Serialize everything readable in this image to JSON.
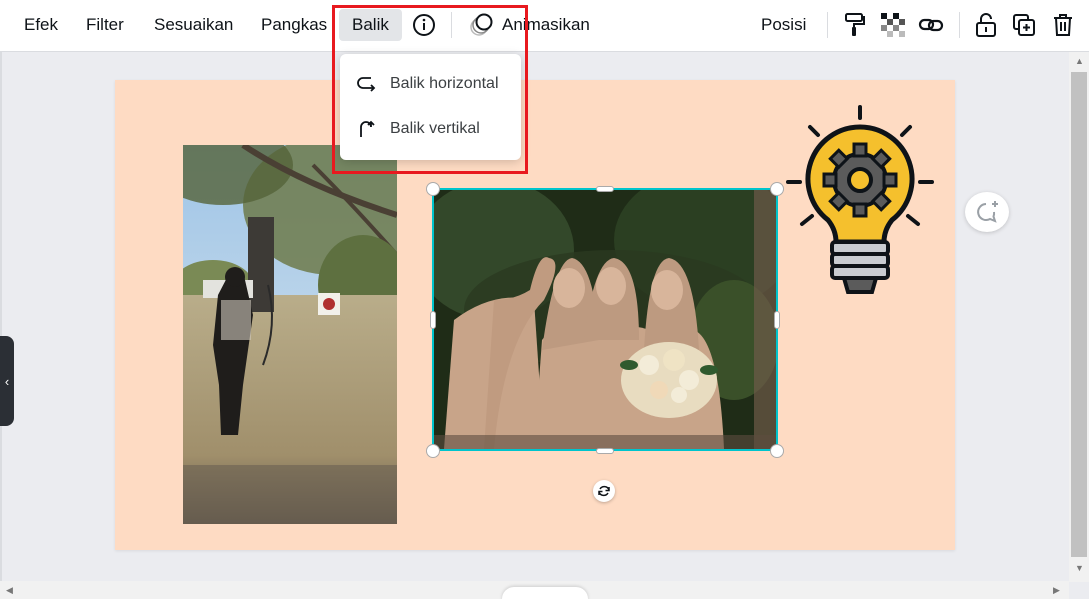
{
  "toolbar": {
    "efek": "Efek",
    "filter": "Filter",
    "sesuaikan": "Sesuaikan",
    "pangkas": "Pangkas",
    "balik": "Balik",
    "animasikan": "Animasikan",
    "posisi": "Posisi",
    "icons": [
      "info-icon",
      "animate-icon",
      "paint-roller-icon",
      "transparency-icon",
      "link-icon",
      "lock-icon",
      "duplicate-icon",
      "trash-icon"
    ]
  },
  "dropdown": {
    "items": [
      {
        "label": "Balik horizontal",
        "icon": "flip-horizontal-icon"
      },
      {
        "label": "Balik vertikal",
        "icon": "flip-vertical-icon"
      }
    ]
  },
  "colors": {
    "page_background": "#fedbc3",
    "selection": "#00c4cc",
    "highlight": "#e8191f",
    "bulb_yellow": "#f5c02d"
  }
}
